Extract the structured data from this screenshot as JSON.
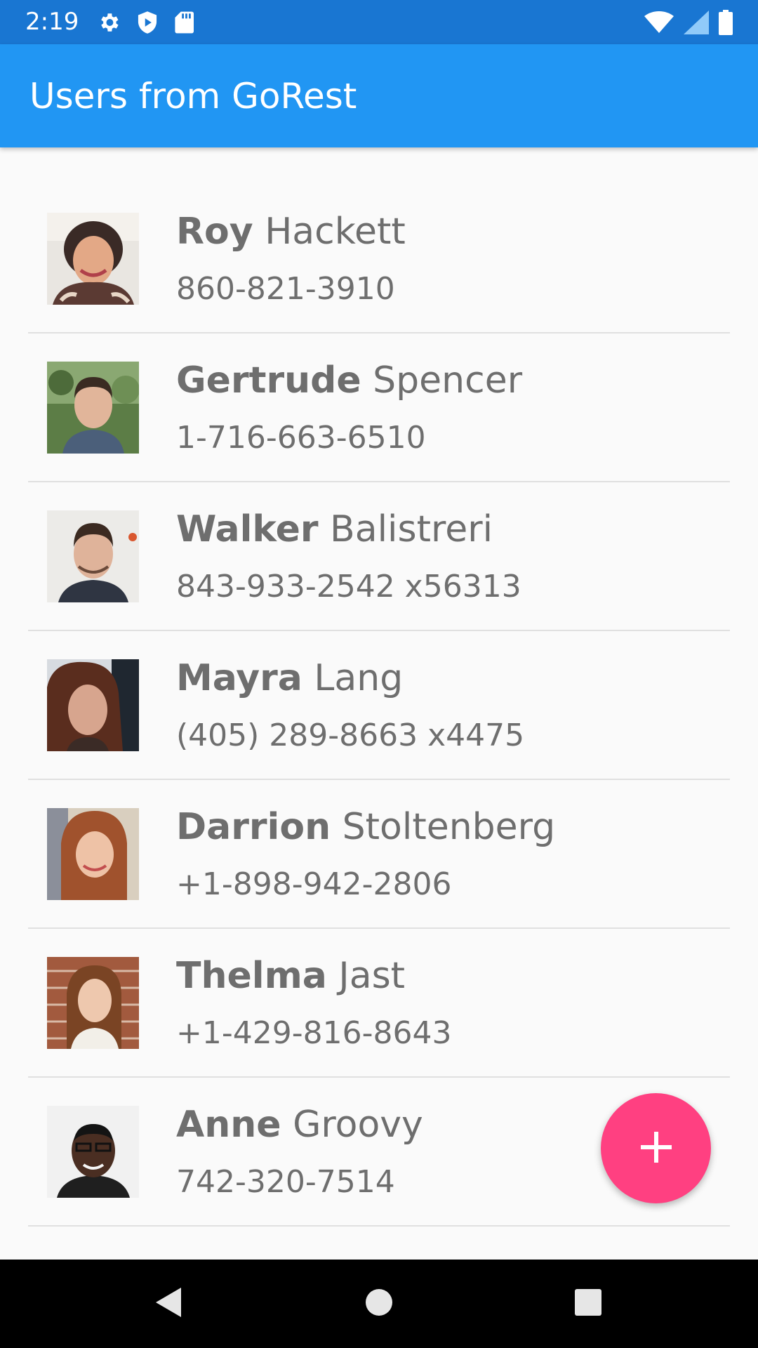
{
  "status_bar": {
    "time": "2:19",
    "left_icons": [
      "gear-icon",
      "shield-play-icon",
      "sd-card-icon"
    ],
    "right_icons": [
      "wifi-icon",
      "cell-signal-icon",
      "battery-icon"
    ]
  },
  "app_bar": {
    "title": "Users from GoRest",
    "color": "#2196f3"
  },
  "users": [
    {
      "first_name": "Roy",
      "last_name": "Hackett",
      "phone": "860-821-3910"
    },
    {
      "first_name": "Gertrude",
      "last_name": "Spencer",
      "phone": "1-716-663-6510"
    },
    {
      "first_name": "Walker",
      "last_name": "Balistreri",
      "phone": "843-933-2542 x56313"
    },
    {
      "first_name": "Mayra",
      "last_name": "Lang",
      "phone": "(405) 289-8663 x4475"
    },
    {
      "first_name": "Darrion",
      "last_name": "Stoltenberg",
      "phone": "+1-898-942-2806"
    },
    {
      "first_name": "Thelma",
      "last_name": "Jast",
      "phone": "+1-429-816-8643"
    },
    {
      "first_name": "Anne",
      "last_name": "Groovy",
      "phone": "742-320-7514"
    }
  ],
  "fab": {
    "icon": "plus-icon",
    "color": "#ff4081"
  },
  "nav_bar": {
    "icons": [
      "back-icon",
      "home-icon",
      "recents-icon"
    ]
  }
}
